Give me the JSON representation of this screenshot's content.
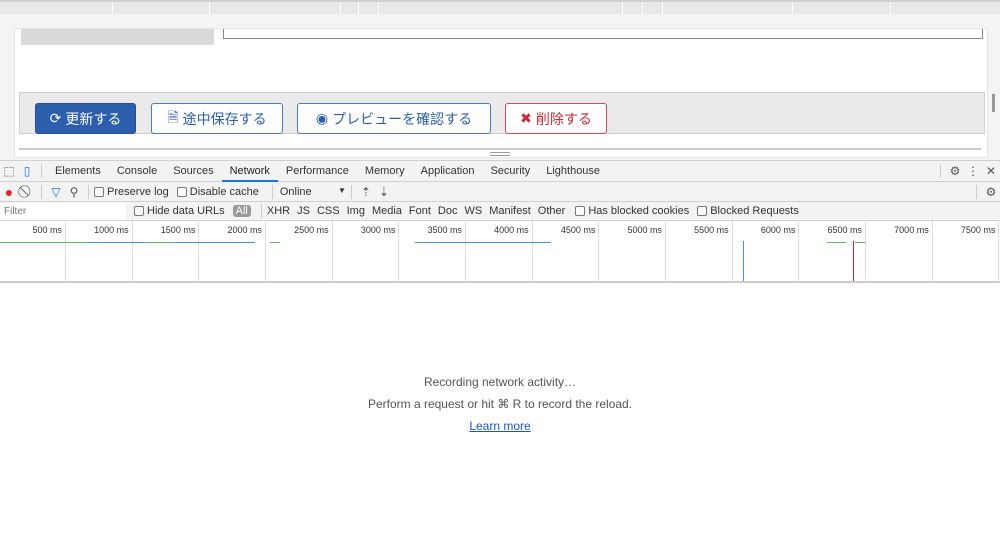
{
  "page": {
    "buttons": {
      "update": "更新する",
      "save_draft": "途中保存する",
      "preview": "プレビューを確認する",
      "delete": "削除する"
    }
  },
  "devtools": {
    "tabs": [
      "Elements",
      "Console",
      "Sources",
      "Network",
      "Performance",
      "Memory",
      "Application",
      "Security",
      "Lighthouse"
    ],
    "active_tab": "Network",
    "toolbar": {
      "preserve_log": "Preserve log",
      "disable_cache": "Disable cache",
      "throttle": "Online"
    },
    "filter": {
      "placeholder": "Filter",
      "hide_data_urls": "Hide data URLs",
      "types": [
        "All",
        "XHR",
        "JS",
        "CSS",
        "Img",
        "Media",
        "Font",
        "Doc",
        "WS",
        "Manifest",
        "Other"
      ],
      "has_blocked_cookies": "Has blocked cookies",
      "blocked_requests": "Blocked Requests"
    },
    "timeline_ticks": [
      "500 ms",
      "1000 ms",
      "1500 ms",
      "2000 ms",
      "2500 ms",
      "3000 ms",
      "3500 ms",
      "4000 ms",
      "4500 ms",
      "5000 ms",
      "5500 ms",
      "6000 ms",
      "6500 ms",
      "7000 ms",
      "7500 ms"
    ],
    "empty": {
      "line1": "Recording network activity…",
      "line2": "Perform a request or hit ⌘ R to record the reload.",
      "link": "Learn more"
    }
  }
}
